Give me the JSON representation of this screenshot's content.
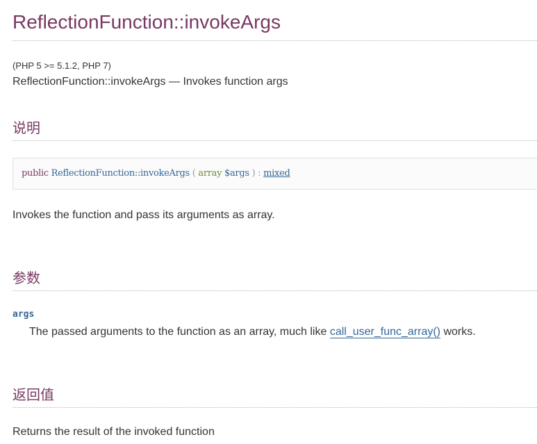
{
  "refname": "ReflectionFunction::invokeArgs",
  "version": "(PHP 5 >= 5.1.2, PHP 7)",
  "purpose": "ReflectionFunction::invokeArgs — Invokes function args",
  "sections": {
    "description": {
      "title": "说明",
      "synopsis": {
        "modifier": "public",
        "method": "ReflectionFunction::invokeArgs",
        "open_paren": "(",
        "param_type": "array",
        "param_name": "$args",
        "close_paren": ")",
        "colon": ":",
        "return_type": "mixed"
      },
      "text": "Invokes the function and pass its arguments as array."
    },
    "parameters": {
      "title": "参数",
      "param_name": "args",
      "param_desc_before": "The passed arguments to the function as an array, much like ",
      "param_link": "call_user_func_array()",
      "param_desc_after": " works."
    },
    "returnvalues": {
      "title": "返回值",
      "text": "Returns the result of the invoked function"
    }
  }
}
